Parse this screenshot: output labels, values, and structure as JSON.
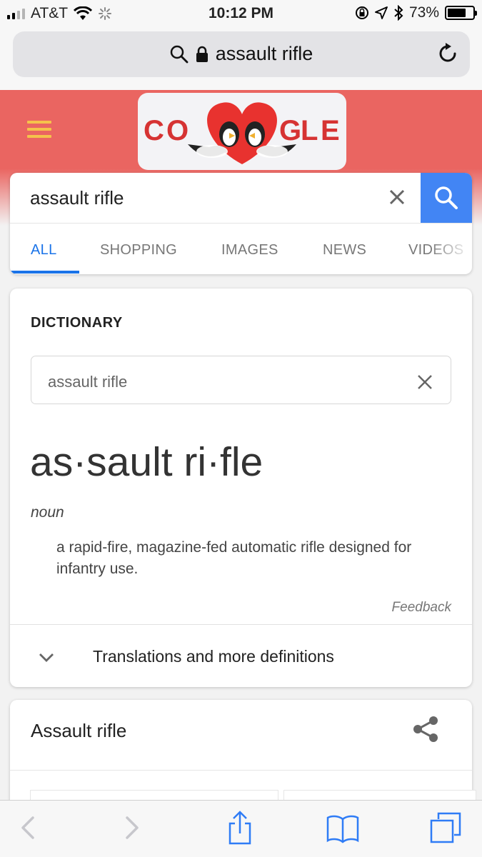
{
  "status_bar": {
    "carrier": "AT&T",
    "time": "10:12 PM",
    "battery": "73%",
    "battery_level": 0.73,
    "icons": [
      "signal-icon",
      "wifi-icon",
      "activity-spinner-icon",
      "orientation-lock-icon",
      "location-icon",
      "bluetooth-icon",
      "battery-icon"
    ]
  },
  "address_bar": {
    "url_text": "assault rifle",
    "icons": [
      "search-icon",
      "lock-icon",
      "reload-icon"
    ]
  },
  "google_header": {
    "doodle_text": "GOOGLE",
    "icons": [
      "menu-icon",
      "doodle-logo"
    ],
    "colors": {
      "header_bg": "#ea6561",
      "menu": "#f5c24b"
    }
  },
  "search": {
    "query": "assault rifle",
    "icons": [
      "clear-icon",
      "search-icon"
    ],
    "button_color": "#4285f4",
    "tabs": [
      {
        "label": "ALL"
      },
      {
        "label": "SHOPPING"
      },
      {
        "label": "IMAGES"
      },
      {
        "label": "NEWS"
      },
      {
        "label": "VIDEOS"
      }
    ],
    "active_tab": "ALL",
    "accent": "#1a73e8"
  },
  "dictionary": {
    "title": "DICTIONARY",
    "field_value": "assault rifle",
    "headword": "as·sault ri·fle",
    "part_of_speech": "noun",
    "definition": "a rapid-fire, magazine-fed automatic rifle designed for infantry use.",
    "feedback": "Feedback",
    "more_label": "Translations and more definitions",
    "icons": [
      "clear-icon",
      "chevron-down-icon"
    ]
  },
  "knowledge_panel": {
    "title": "Assault rifle",
    "icons": [
      "share-icon"
    ]
  },
  "toolbar": {
    "icons": [
      "back-icon",
      "forward-icon",
      "share-icon",
      "bookmarks-icon",
      "tabs-icon"
    ],
    "accent": "#2f7cf6"
  }
}
